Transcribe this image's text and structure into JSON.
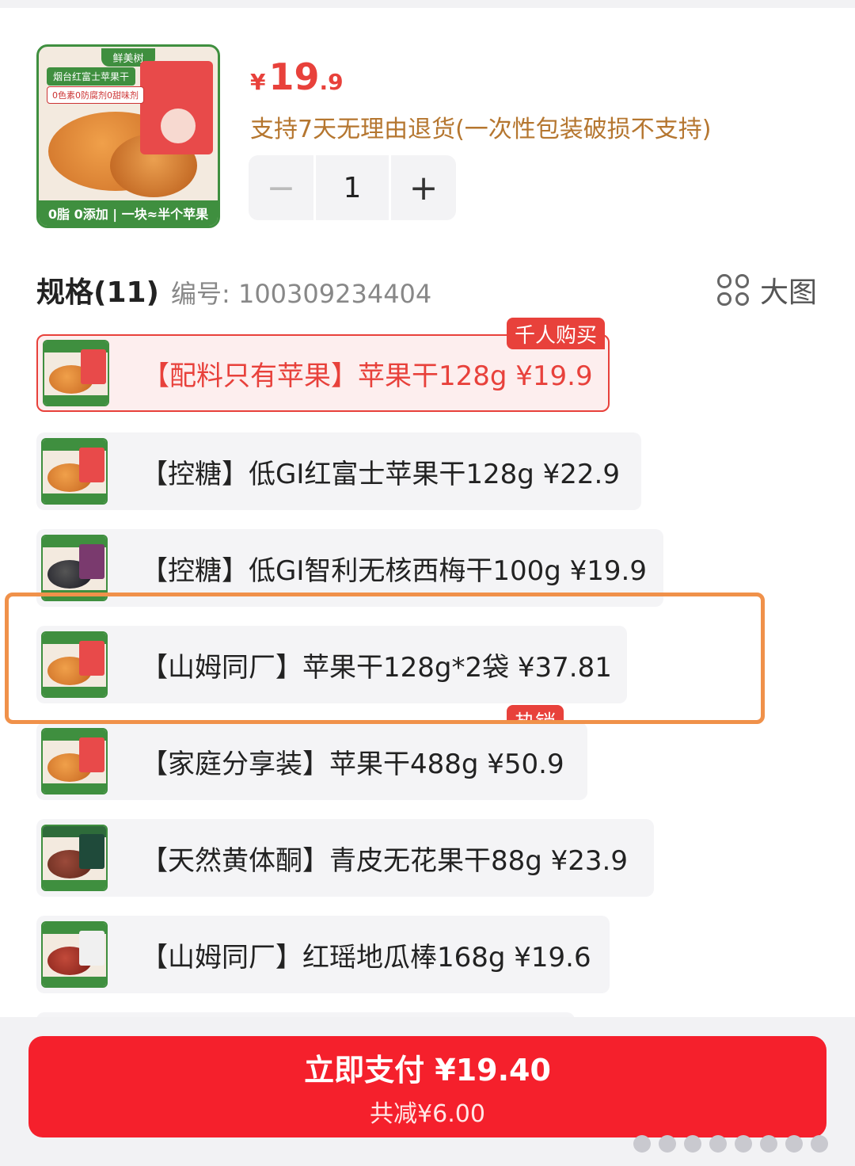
{
  "product": {
    "thumb": {
      "brand": "鲜美树",
      "tag1": "烟台红富士苹果干",
      "tag2": "0色素0防腐剂0甜味剂",
      "footer": "0脂 0添加 | 一块≈半个苹果"
    },
    "price": {
      "currency": "¥",
      "integer": "19",
      "decimal": ".9"
    },
    "return_note": "支持7天无理由退货(一次性包装破损不支持)",
    "stepper": {
      "minus": "−",
      "quantity": "1",
      "plus": "+"
    }
  },
  "spec": {
    "title": "规格(11)",
    "code": "编号: 100309234404",
    "big_view_label": "大图",
    "items": [
      {
        "label": "【配料只有苹果】苹果干128g  ¥19.9",
        "selected": true,
        "badge": "千人购买",
        "thumb": "apple-chips"
      },
      {
        "label": "【控糖】低GI红富士苹果干128g  ¥22.9",
        "thumb": "apple-chips"
      },
      {
        "label": "【控糖】低GI智利无核西梅干100g  ¥19.9",
        "thumb": "prune"
      },
      {
        "label": "【山姆同厂】苹果干128g*2袋  ¥37.81",
        "thumb": "apple-chips"
      },
      {
        "label": "【家庭分享装】苹果干488g  ¥50.9",
        "badge": "热销",
        "thumb": "apple-chips"
      },
      {
        "label": "【天然黄体酮】青皮无花果干88g  ¥23.9",
        "thumb": "fig"
      },
      {
        "label": "【山姆同厂】红瑶地瓜棒168g  ¥19.6",
        "thumb": "sweet-potato"
      }
    ]
  },
  "pay": {
    "main": "立即支付 ¥19.40",
    "sub": "共减¥6.00"
  },
  "colors": {
    "accent": "#e8413b",
    "pay_button": "#f5202c",
    "highlight": "#f0914a",
    "return_note": "#b5762f"
  }
}
